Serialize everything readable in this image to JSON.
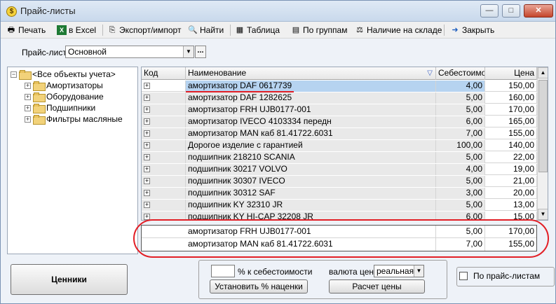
{
  "window": {
    "title": "Прайс-листы",
    "controls": {
      "minimize": "—",
      "maximize": "□",
      "close": "✕"
    }
  },
  "toolbar": {
    "print": "Печать",
    "excel": "в Excel",
    "export_import": "Экспорт/импорт",
    "find": "Найти",
    "table": "Таблица",
    "by_groups": "По группам",
    "in_stock": "Наличие на складе",
    "close": "Закрыть"
  },
  "pricelist": {
    "label": "Прайс-лист",
    "selected": "Основной",
    "dots": "..."
  },
  "tree": {
    "root": "<Все объекты учета>",
    "items": [
      "Амортизаторы",
      "Оборудование",
      "Подшипники",
      "Фильтры масляные"
    ]
  },
  "grid": {
    "columns": {
      "code": "Код",
      "name": "Наименование",
      "cost": "Себестоимо",
      "price": "Цена"
    },
    "rows": [
      {
        "name": "амортизатор DAF 0617739",
        "cost": "4,00",
        "price": "150,00"
      },
      {
        "name": "амортизатор DAF 1282625",
        "cost": "5,00",
        "price": "160,00"
      },
      {
        "name": "амортизатор FRH UJB0177-001",
        "cost": "5,00",
        "price": "170,00"
      },
      {
        "name": "амортизатор IVECO 4103334 передн",
        "cost": "6,00",
        "price": "165,00"
      },
      {
        "name": "амортизатор MAN каб 81.41722.6031",
        "cost": "7,00",
        "price": "155,00"
      },
      {
        "name": "Дорогое изделие с гарантией",
        "cost": "100,00",
        "price": "140,00"
      },
      {
        "name": "подшипник 218210 SCANIA",
        "cost": "5,00",
        "price": "22,00"
      },
      {
        "name": "подшипник 30217 VOLVO",
        "cost": "4,00",
        "price": "19,00"
      },
      {
        "name": "подшипник 30307 IVECO",
        "cost": "5,00",
        "price": "21,00"
      },
      {
        "name": "подшипник 30312 SAF",
        "cost": "3,00",
        "price": "20,00"
      },
      {
        "name": "подшипник KY 32310 JR",
        "cost": "5,00",
        "price": "13,00"
      },
      {
        "name": "подшипник KY HI-CAP 32208 JR",
        "cost": "6,00",
        "price": "15,00"
      }
    ]
  },
  "summary": {
    "rows": [
      {
        "name": "амортизатор FRH UJB0177-001",
        "cost": "5,00",
        "price": "170,00"
      },
      {
        "name": "амортизатор MAN каб 81.41722.6031",
        "cost": "7,00",
        "price": "155,00"
      }
    ]
  },
  "bottom": {
    "tags_button": "Ценники",
    "pct_label": "% к себестоимости",
    "set_markup": "Установить % наценки",
    "currency_label": "валюта цен",
    "currency_value": "реальная",
    "calc_prices": "Расчет цены",
    "by_pricelists": "По прайс-листам"
  },
  "colors": {
    "highlight": "#e21f26",
    "selection": "#b6d3f0"
  }
}
